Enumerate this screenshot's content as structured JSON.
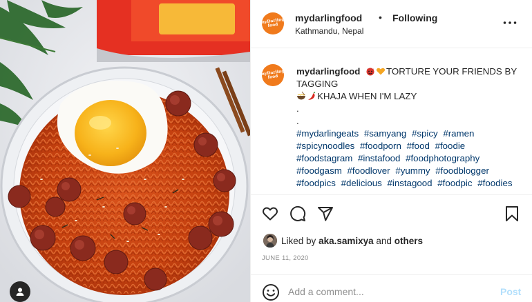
{
  "post": {
    "username": "mydarlingfood",
    "separator": "•",
    "follow_status": "Following",
    "location": "Kathmandu, Nepal",
    "avatar_text": "myDarling food",
    "caption": {
      "username": "mydarlingfood",
      "line1_text": "TORTURE YOUR FRIENDS BY TAGGING",
      "line1_emojis": [
        "devil-face-emoji",
        "orange-heart-emoji"
      ],
      "line2_text": "KHAJA WHEN I'M LAZY",
      "line2_emojis": [
        "noodle-bowl-emoji",
        "chili-pepper-emoji"
      ],
      "dot1": ".",
      "dot2": ".",
      "hashtags": [
        "#mydarlingeats",
        "#samyang",
        "#spicy",
        "#ramen",
        "#spicynoodles",
        "#foodporn",
        "#food",
        "#foodie",
        "#foodstagram",
        "#instafood",
        "#foodphotography",
        "#foodgasm",
        "#foodlover",
        "#yummy",
        "#foodblogger",
        "#foodpics",
        "#delicious",
        "#instagood",
        "#foodpic",
        "#foodies"
      ]
    },
    "likes": {
      "prefix": "Liked by",
      "user": "aka.samixya",
      "conj": "and",
      "others": "others"
    },
    "date": "JUNE 11, 2020",
    "comment": {
      "placeholder": "Add a comment...",
      "value": "",
      "post_label": "Post"
    },
    "icons": {
      "like": "heart-icon",
      "comment": "comment-bubble-icon",
      "share": "paper-plane-icon",
      "save": "bookmark-icon",
      "more": "more-options-icon",
      "emoji": "smiley-icon",
      "user_tags": "user-tag-icon"
    },
    "colors": {
      "link": "#00376b",
      "post_disabled": "#b2dffc",
      "muted": "#8e8e8e",
      "avatar_bg": "#f07a1c",
      "text": "#262626"
    }
  }
}
